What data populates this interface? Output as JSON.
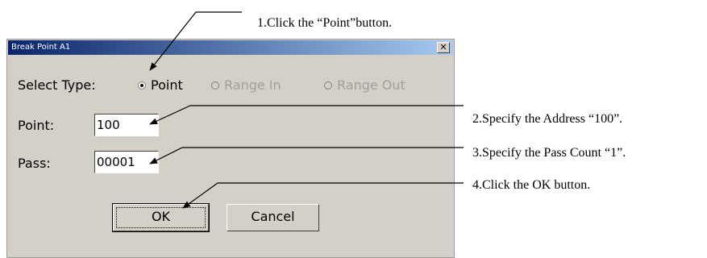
{
  "dialog": {
    "title": "Break Point A1",
    "close_glyph": "✕",
    "select_type_label": "Select Type:",
    "options": [
      {
        "label": "Point",
        "selected": true,
        "enabled": true
      },
      {
        "label": "Range In",
        "selected": false,
        "enabled": false
      },
      {
        "label": "Range Out",
        "selected": false,
        "enabled": false
      }
    ],
    "point_label": "Point:",
    "point_value": "100",
    "pass_label": "Pass:",
    "pass_value": "00001",
    "ok_label": "OK",
    "cancel_label": "Cancel"
  },
  "annotations": [
    "1.Click the “Point”button.",
    "2.Specify the Address “100”.",
    "3.Specify the Pass Count “1”.",
    "4.Click the OK button."
  ],
  "colors": {
    "dialog_bg": "#d4d0c8",
    "title_start": "#0a246a",
    "title_end": "#a6caf0"
  }
}
